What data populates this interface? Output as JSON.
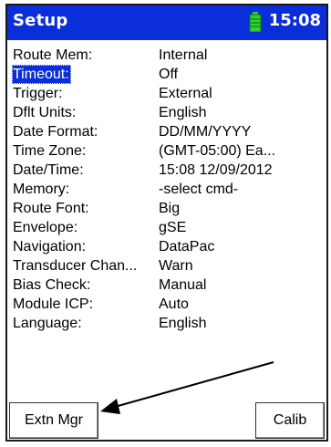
{
  "header": {
    "title": "Setup",
    "time": "15:08",
    "battery_color": "#2fd12f",
    "bar_color": "#0a2ed9"
  },
  "settings": [
    {
      "label": "Route Mem:",
      "value": "Internal"
    },
    {
      "label": "Timeout:",
      "value": "Off",
      "selected": true
    },
    {
      "label": "Trigger:",
      "value": "External"
    },
    {
      "label": "Dflt Units:",
      "value": "English"
    },
    {
      "label": "Date Format:",
      "value": "DD/MM/YYYY"
    },
    {
      "label": "Time Zone:",
      "value": "(GMT-05:00) Ea..."
    },
    {
      "label": "Date/Time:",
      "value": "15:08 12/09/2012"
    },
    {
      "label": "Memory:",
      "value": "-select cmd-"
    },
    {
      "label": "Route Font:",
      "value": "Big"
    },
    {
      "label": "Envelope:",
      "value": "gSE"
    },
    {
      "label": "Navigation:",
      "value": "DataPac"
    },
    {
      "label": "Transducer Chan...",
      "value": "Warn"
    },
    {
      "label": "Bias Check:",
      "value": "Manual"
    },
    {
      "label": "Module ICP:",
      "value": "Auto"
    },
    {
      "label": "Language:",
      "value": "English"
    }
  ],
  "softkeys": {
    "left": "Extn Mgr",
    "right": "Calib"
  },
  "annotation": {
    "icon": "arrow-pointer",
    "color": "#000000"
  }
}
